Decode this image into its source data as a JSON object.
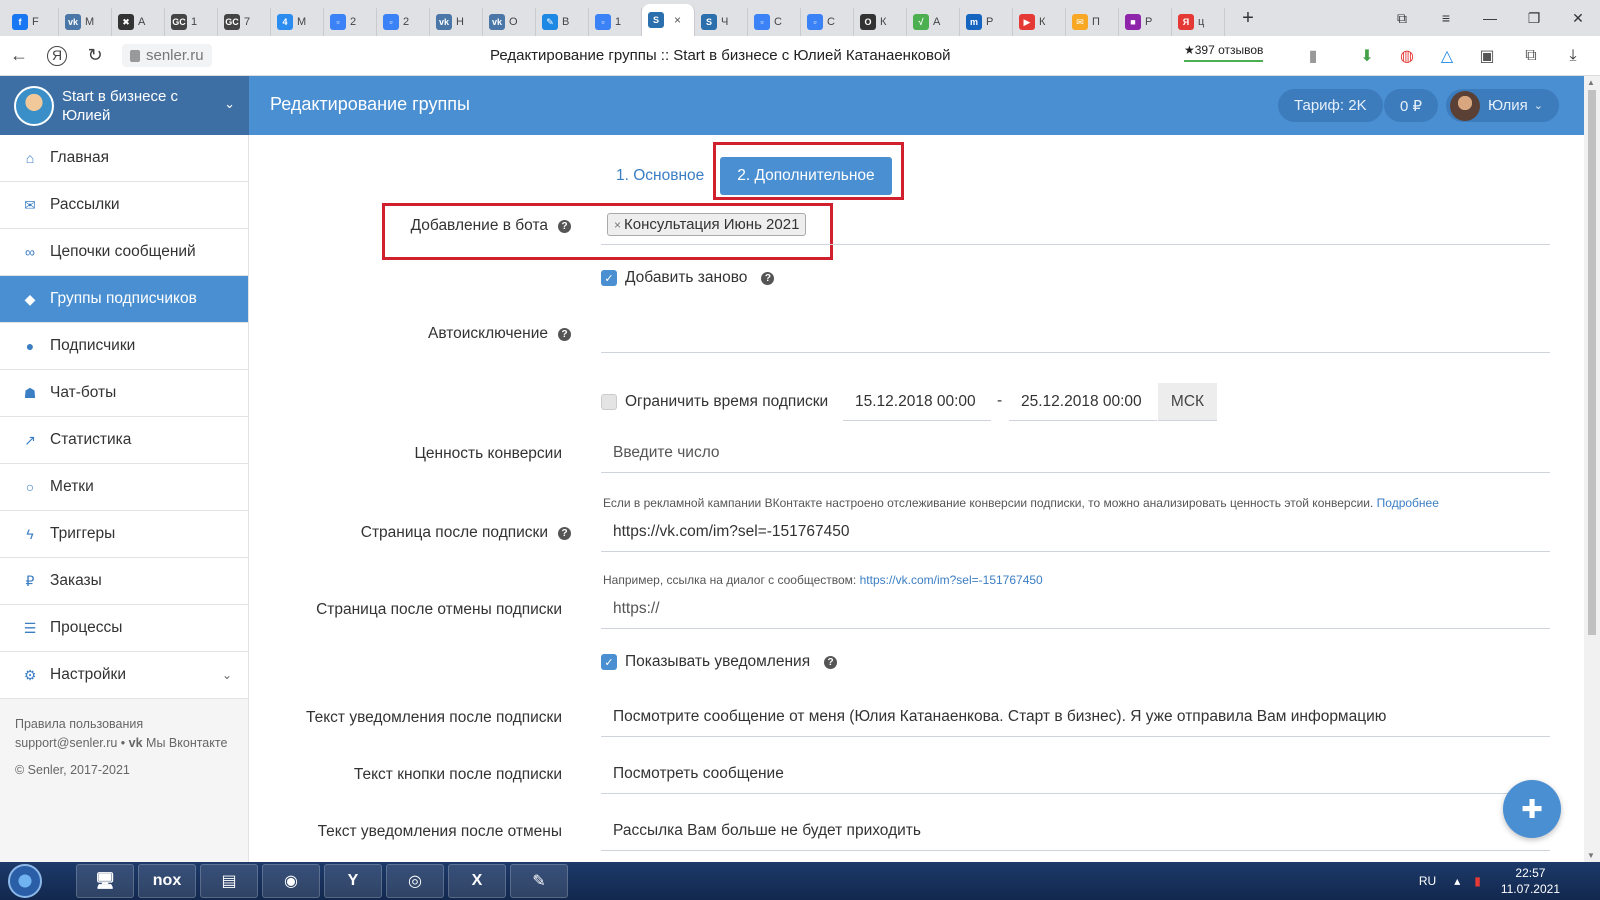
{
  "browser": {
    "tabs": [
      {
        "icon": "facebook-icon",
        "label": "F",
        "color": "#1877f2",
        "glyph": "f"
      },
      {
        "icon": "vk-icon",
        "label": "М",
        "color": "#4a76a8",
        "glyph": "vk"
      },
      {
        "icon": "app-icon",
        "label": "А",
        "color": "#333333",
        "glyph": "✖"
      },
      {
        "icon": "gc-icon",
        "label": "1",
        "color": "#444444",
        "glyph": "GC"
      },
      {
        "icon": "gc-icon",
        "label": "7",
        "color": "#444444",
        "glyph": "GC"
      },
      {
        "icon": "four-icon",
        "label": "М",
        "color": "#2d8cf0",
        "glyph": "4"
      },
      {
        "icon": "chat-icon",
        "label": "2",
        "color": "#3b82f6",
        "glyph": "▫"
      },
      {
        "icon": "chat-icon",
        "label": "2",
        "color": "#3b82f6",
        "glyph": "▫"
      },
      {
        "icon": "vk-icon",
        "label": "Н",
        "color": "#4a76a8",
        "glyph": "vk"
      },
      {
        "icon": "vk-icon",
        "label": "О",
        "color": "#4a76a8",
        "glyph": "vk"
      },
      {
        "icon": "pen-icon",
        "label": "В",
        "color": "#1e88e5",
        "glyph": "✎"
      },
      {
        "icon": "chat-icon",
        "label": "1",
        "color": "#3b82f6",
        "glyph": "▫"
      },
      {
        "icon": "senler-icon",
        "label": "",
        "color": "#2c6fad",
        "glyph": "S"
      },
      {
        "icon": "senler-icon",
        "label": "Ч",
        "color": "#2c6fad",
        "glyph": "S"
      },
      {
        "icon": "chat-icon",
        "label": "С",
        "color": "#3b82f6",
        "glyph": "▫"
      },
      {
        "icon": "chat-icon",
        "label": "С",
        "color": "#3b82f6",
        "glyph": "▫"
      },
      {
        "icon": "circle-icon",
        "label": "К",
        "color": "#333333",
        "glyph": "O"
      },
      {
        "icon": "check-icon",
        "label": "А",
        "color": "#4caf50",
        "glyph": "√"
      },
      {
        "icon": "m-icon",
        "label": "Р",
        "color": "#1565c0",
        "glyph": "m"
      },
      {
        "icon": "youtube-icon",
        "label": "К",
        "color": "#e53935",
        "glyph": "▶"
      },
      {
        "icon": "mail-icon",
        "label": "П",
        "color": "#f9a825",
        "glyph": "✉"
      },
      {
        "icon": "photo-icon",
        "label": "Р",
        "color": "#8e24aa",
        "glyph": "■"
      },
      {
        "icon": "yandex-icon",
        "label": "ц",
        "color": "#e53935",
        "glyph": "Я"
      }
    ],
    "active_tab_close": "×",
    "new_tab": "+",
    "url": "senler.ru",
    "title": "Редактирование группы :: Start в бизнесе с Юлией Катанаенковой",
    "reviews": "★397 отзывов"
  },
  "app": {
    "brand_name": "Start в бизнесе с Юлией",
    "header_title": "Редактирование группы",
    "tariff": "Тариф: 2K",
    "balance": "0 ₽",
    "user": "Юлия"
  },
  "sidebar": {
    "items": [
      {
        "label": "Главная",
        "icon": "home-icon",
        "glyph": "⌂"
      },
      {
        "label": "Рассылки",
        "icon": "envelope-icon",
        "glyph": "✉"
      },
      {
        "label": "Цепочки сообщений",
        "icon": "link-icon",
        "glyph": "∞"
      },
      {
        "label": "Группы подписчиков",
        "icon": "tags-icon",
        "glyph": "◆"
      },
      {
        "label": "Подписчики",
        "icon": "users-icon",
        "glyph": "●"
      },
      {
        "label": "Чат-боты",
        "icon": "android-icon",
        "glyph": "☗"
      },
      {
        "label": "Статистика",
        "icon": "chart-icon",
        "glyph": "↗"
      },
      {
        "label": "Метки",
        "icon": "circle-icon",
        "glyph": "○"
      },
      {
        "label": "Триггеры",
        "icon": "bolt-icon",
        "glyph": "ϟ"
      },
      {
        "label": "Заказы",
        "icon": "ruble-icon",
        "glyph": "₽"
      },
      {
        "label": "Процессы",
        "icon": "server-icon",
        "glyph": "☰"
      },
      {
        "label": "Настройки",
        "icon": "cogs-icon",
        "glyph": "⚙"
      }
    ],
    "footer_terms": "Правила пользования",
    "footer_support": "support@senler.ru • ",
    "footer_vk": "Мы Вконтакте",
    "footer_copy": "© Senler, 2017-2021"
  },
  "form": {
    "step1": "1. Основное",
    "step2": "2. Дополнительное",
    "add_to_bot_label": "Добавление в бота",
    "add_to_bot_tag": "Консультация Июнь 2021",
    "readd_label": "Добавить заново",
    "readd_checked": true,
    "auto_exclude_label": "Автоисключение",
    "limit_time_label": "Ограничить время подписки",
    "limit_time_checked": false,
    "date_from": "15.12.2018 00:00",
    "date_sep": "-",
    "date_to": "25.12.2018 00:00",
    "timezone": "МСК",
    "conversion_label": "Ценность конверсии",
    "conversion_placeholder": "Введите число",
    "conversion_hint": "Если в рекламной кампании ВКонтакте настроено отслеживание конверсии подписки, то можно анализировать ценность этой конверсии.",
    "conversion_hint_link": "Подробнее",
    "after_sub_label": "Страница после подписки",
    "after_sub_value": "https://vk.com/im?sel=-151767450",
    "after_sub_hint": "Например, ссылка на диалог с сообществом:",
    "after_sub_hint_link": "https://vk.com/im?sel=-151767450",
    "after_unsub_label": "Страница после отмены подписки",
    "after_unsub_value": "https://",
    "show_notif_label": "Показывать уведомления",
    "show_notif_checked": true,
    "notif_text_label": "Текст уведомления после подписки",
    "notif_text_value": "Посмотрите сообщение от меня (Юлия Катанаенкова. Старт в бизнес). Я уже отправила Вам информацию",
    "button_text_label": "Текст кнопки после подписки",
    "button_text_value": "Посмотреть сообщение",
    "unsub_notif_label": "Текст уведомления после отмены",
    "unsub_notif_value": "Рассылка Вам больше не будет приходить"
  },
  "taskbar": {
    "apps": [
      {
        "icon": "computer-icon",
        "glyph": "🖥"
      },
      {
        "icon": "nox-icon",
        "glyph": "nox"
      },
      {
        "icon": "folder-icon",
        "glyph": "▤"
      },
      {
        "icon": "chrome-icon",
        "glyph": "◉"
      },
      {
        "icon": "yandex-browser-icon",
        "glyph": "Y"
      },
      {
        "icon": "camera-icon",
        "glyph": "◎"
      },
      {
        "icon": "excel-icon",
        "glyph": "X"
      },
      {
        "icon": "paint-icon",
        "glyph": "✎"
      }
    ],
    "lang": "RU",
    "time": "22:57",
    "date": "11.07.2021"
  },
  "colors": {
    "accent": "#4a8fd2",
    "brand_dark": "#3d6fa5",
    "highlight_red": "#d0202e"
  }
}
